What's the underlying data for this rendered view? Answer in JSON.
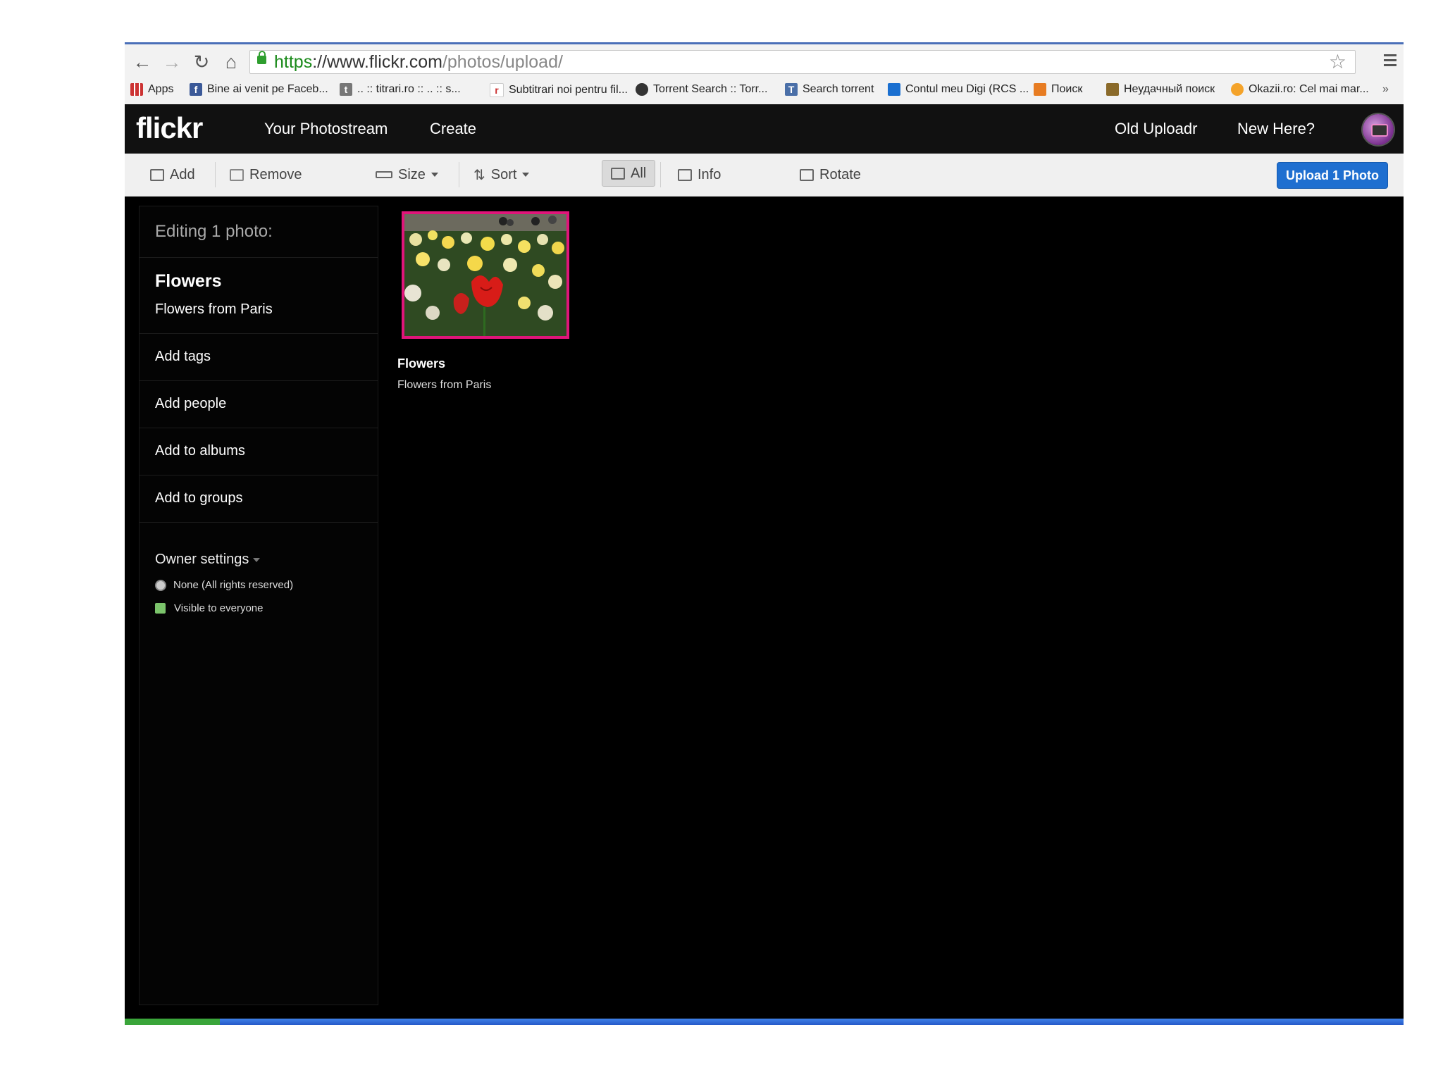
{
  "browser": {
    "url_scheme": "https",
    "url_host": "://www.flickr.com",
    "url_path": "/photos/upload/",
    "icons": [
      "back-arrow-icon",
      "forward-arrow-icon",
      "reload-icon",
      "home-icon",
      "lock-icon",
      "star-icon",
      "menu-icon"
    ],
    "bookmarks": [
      {
        "label": "Apps"
      },
      {
        "label": "Bine ai venit pe Faceb..."
      },
      {
        "label": ".. :: titrari.ro :: .. :: s..."
      },
      {
        "label": "Subtitrari noi pentru fil..."
      },
      {
        "label": "Torrent Search :: Torr..."
      },
      {
        "label": "Search torrent"
      },
      {
        "label": "Contul meu Digi (RCS ..."
      },
      {
        "label": "Поиск"
      },
      {
        "label": "Неудачный поиск"
      },
      {
        "label": "Okazii.ro: Cel mai mar..."
      }
    ],
    "more_bookmarks": "»"
  },
  "header": {
    "logo": "flickr",
    "nav": {
      "photostream": "Your Photostream",
      "create": "Create",
      "old_uploadr": "Old Uploadr",
      "new_here": "New Here?"
    }
  },
  "toolbar": {
    "add": "Add",
    "remove": "Remove",
    "size": "Size",
    "sort": "Sort",
    "all": "All",
    "info": "Info",
    "rotate": "Rotate",
    "upload": "Upload 1 Photo"
  },
  "sidepanel": {
    "editing": "Editing 1 photo:",
    "photo_title": "Flowers",
    "photo_description": "Flowers from Paris",
    "add_tags": "Add tags",
    "add_people": "Add people",
    "add_albums": "Add to albums",
    "add_groups": "Add to groups",
    "owner_settings": "Owner settings",
    "license": "None (All rights reserved)",
    "visibility": "Visible to everyone"
  },
  "photo": {
    "title": "Flowers",
    "description": "Flowers from Paris"
  },
  "colors": {
    "accent_pink": "#e0157a",
    "upload_blue": "#1f6fd0",
    "visibility_green": "#7bc46b"
  }
}
